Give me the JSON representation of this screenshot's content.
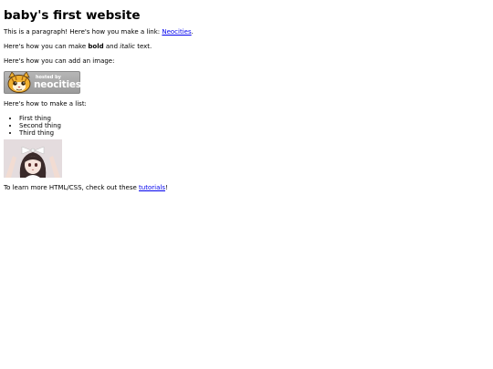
{
  "page": {
    "title": "baby's first website",
    "p1_text": "This is a paragraph! Here's how you make a link: ",
    "p1_link": "Neocities",
    "p1_end": ".",
    "p2_a": "Here's how you can make ",
    "p2_bold": "bold",
    "p2_b": " and ",
    "p2_italic": "italic",
    "p2_c": " text.",
    "p3": "Here's how you can add an image:",
    "badge": {
      "hosted": "hosted by",
      "brand": "neocities",
      "colors": {
        "face": "#f0b030",
        "bg": "#a9a9a9"
      }
    },
    "p4": "Here's how to make a list:",
    "list": [
      "First thing",
      "Second thing",
      "Third thing"
    ],
    "p5_text": "To learn more HTML/CSS, check out these ",
    "p5_link": "tutorials",
    "p5_end": "!"
  }
}
